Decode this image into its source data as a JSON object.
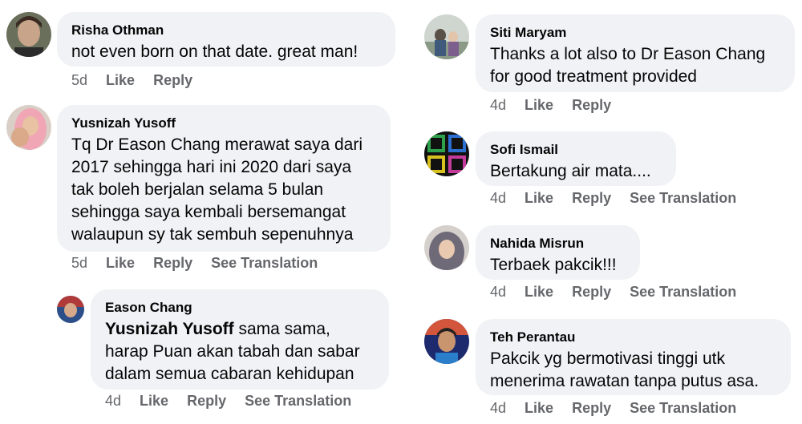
{
  "comments": [
    {
      "name": "Risha Othman",
      "text": [
        "not even born on that date. great man!"
      ],
      "time": "5d",
      "like": "Like",
      "reply": "Reply"
    },
    {
      "name": "Yusnizah Yusoff",
      "text": [
        "Tq Dr Eason Chang merawat saya dari",
        "2017 sehingga hari ini 2020 dari saya",
        "tak boleh berjalan selama 5 bulan",
        "sehingga saya kembali bersemangat",
        "walaupun sy tak sembuh sepenuhnya"
      ],
      "time": "5d",
      "like": "Like",
      "reply": "Reply",
      "translate": "See Translation"
    },
    {
      "name": "Eason Chang",
      "mention": "Yusnizah Yusoff",
      "text": [
        " sama sama,",
        "harap Puan akan tabah dan sabar",
        "dalam semua cabaran kehidupan"
      ],
      "time": "4d",
      "like": "Like",
      "reply": "Reply",
      "translate": "See Translation"
    },
    {
      "name": "Siti Maryam",
      "text": [
        "Thanks a lot also to Dr Eason Chang",
        "for good treatment provided"
      ],
      "time": "4d",
      "like": "Like",
      "reply": "Reply"
    },
    {
      "name": "Sofi Ismail",
      "text": [
        "Bertakung air mata...."
      ],
      "time": "4d",
      "like": "Like",
      "reply": "Reply",
      "translate": "See Translation"
    },
    {
      "name": "Nahida Misrun",
      "text": [
        "Terbaek pakcik!!!"
      ],
      "time": "4d",
      "like": "Like",
      "reply": "Reply",
      "translate": "See Translation"
    },
    {
      "name": "Teh Perantau",
      "text": [
        "Pakcik yg bermotivasi tinggi utk",
        "menerima rawatan tanpa putus asa."
      ],
      "time": "4d",
      "like": "Like",
      "reply": "Reply",
      "translate": "See Translation"
    }
  ],
  "colors": {
    "bubble": "#f0f2f5",
    "meta": "#65676b",
    "text": "#050505"
  }
}
